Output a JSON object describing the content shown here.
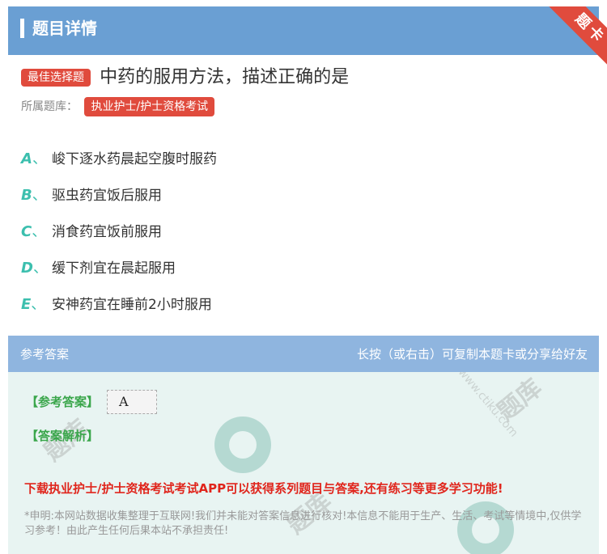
{
  "header": {
    "title": "题目详情",
    "ribbon": "题卡"
  },
  "question": {
    "badge": "最佳选择题",
    "text": "中药的服用方法，描述正确的是",
    "bank_label": "所属题库：",
    "bank_tag": "执业护士/护士资格考试"
  },
  "options": [
    {
      "letter": "A",
      "sep": "、",
      "text": "峻下逐水药晨起空腹时服药"
    },
    {
      "letter": "B",
      "sep": "、",
      "text": "驱虫药宜饭后服用"
    },
    {
      "letter": "C",
      "sep": "、",
      "text": "消食药宜饭前服用"
    },
    {
      "letter": "D",
      "sep": "、",
      "text": "缓下剂宜在晨起服用"
    },
    {
      "letter": "E",
      "sep": "、",
      "text": "安神药宜在睡前2小时服用"
    }
  ],
  "answer_section": {
    "title": "参考答案",
    "hint": "长按（或右击）可复制本题卡或分享给好友",
    "answer_label": "【参考答案】",
    "answer_value": "A",
    "analysis_label": "【答案解析】",
    "promo": "下载执业护士/护士资格考试考试APP可以获得系列题目与答案,还有练习等更多学习功能!",
    "disclaimer": "*申明:本网站数据收集整理于互联网!我们并未能对答案信息进行核对!本信息不能用于生产、生活、考试等情境中,仅供学习参考！由此产生任何后果本站不承担责任!",
    "watermark": "www.ctiku.com"
  },
  "colors": {
    "header_bg": "#6a9fd3",
    "accent_red": "#e04b3d",
    "option_letter": "#3cbfae",
    "answer_label": "#3aa64b",
    "promo": "#e0251c"
  }
}
